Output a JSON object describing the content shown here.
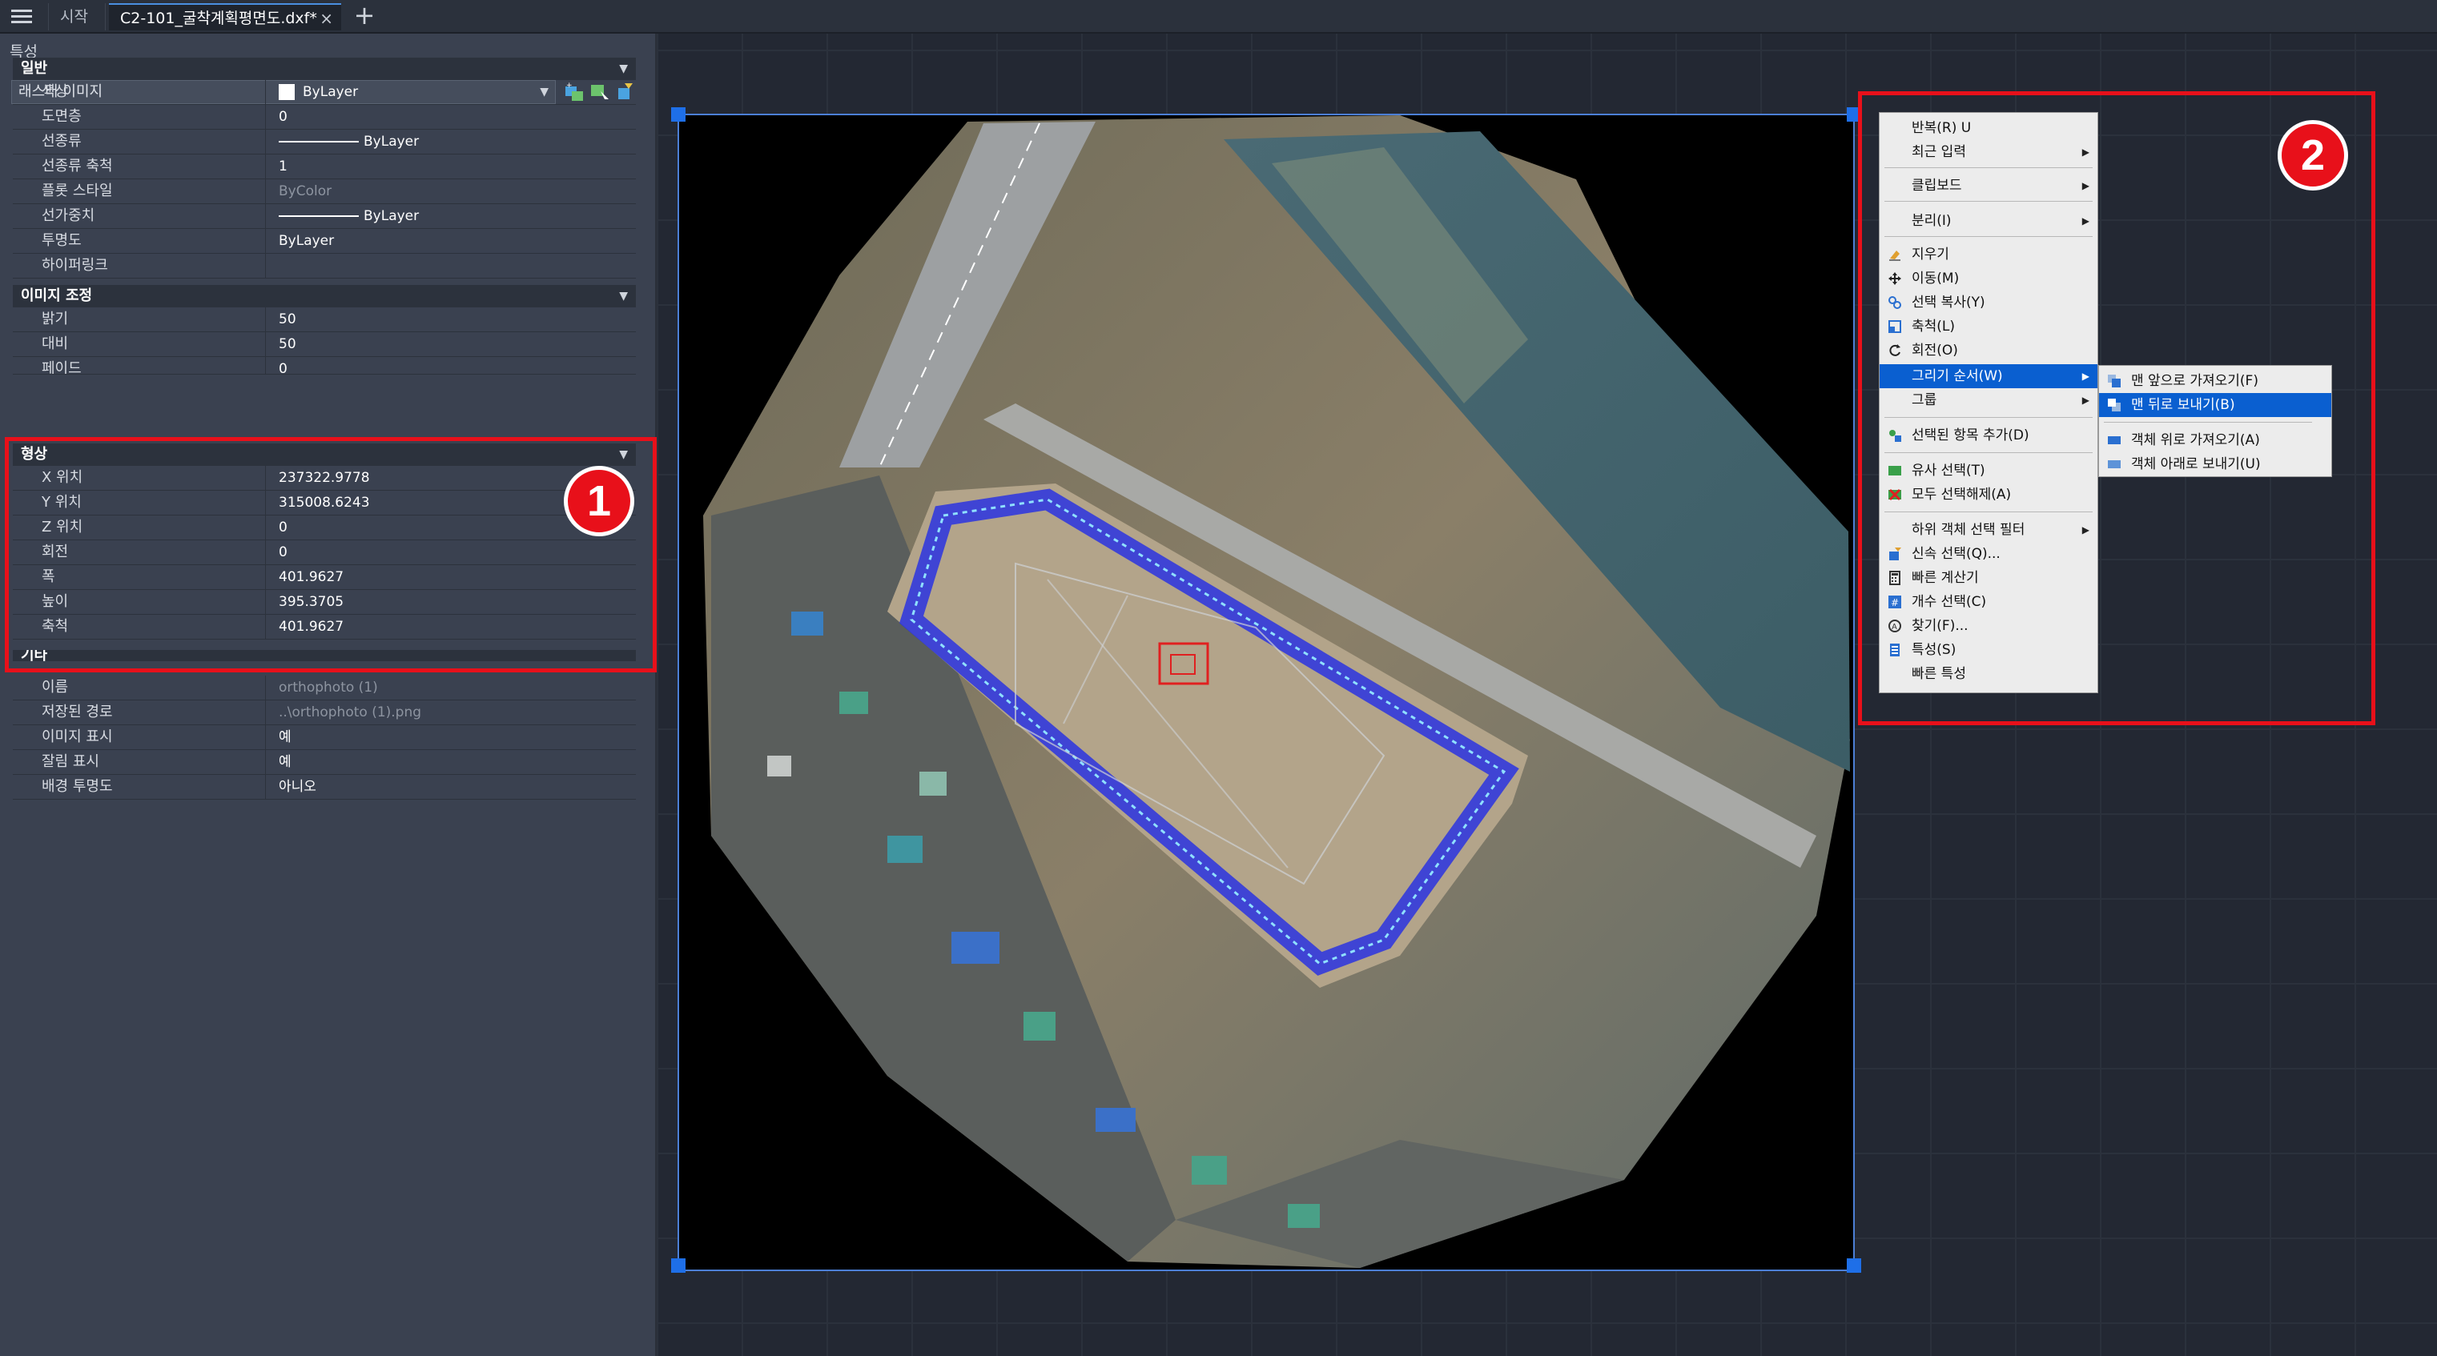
{
  "tabs": {
    "start": "시작",
    "document": "C2-101_굴착계획평면도.dxf*",
    "close": "×",
    "add": "+"
  },
  "panel": {
    "title": "특성",
    "object_type": "래스터 이미지",
    "sections": {
      "general": "일반",
      "image_adjust": "이미지 조정",
      "geometry": "형상",
      "misc": "기타"
    },
    "general_rows": [
      {
        "label": "색상",
        "value": "ByLayer"
      },
      {
        "label": "도면층",
        "value": "0"
      },
      {
        "label": "선종류",
        "value": "ByLayer"
      },
      {
        "label": "선종류 축척",
        "value": "1"
      },
      {
        "label": "플롯 스타일",
        "value": "ByColor"
      },
      {
        "label": "선가중치",
        "value": "ByLayer"
      },
      {
        "label": "투명도",
        "value": "ByLayer"
      },
      {
        "label": "하이퍼링크",
        "value": ""
      }
    ],
    "adjust_rows": [
      {
        "label": "밝기",
        "value": "50"
      },
      {
        "label": "대비",
        "value": "50"
      },
      {
        "label": "페이드",
        "value": "0"
      }
    ],
    "geometry_rows": [
      {
        "label": "X 위치",
        "value": "237322.9778"
      },
      {
        "label": "Y 위치",
        "value": "315008.6243"
      },
      {
        "label": "Z 위치",
        "value": "0"
      },
      {
        "label": "회전",
        "value": "0"
      },
      {
        "label": "폭",
        "value": "401.9627"
      },
      {
        "label": "높이",
        "value": "395.3705"
      },
      {
        "label": "축척",
        "value": "401.9627"
      }
    ],
    "misc_rows": [
      {
        "label": "이름",
        "value": "orthophoto (1)"
      },
      {
        "label": "저장된 경로",
        "value": "..\\orthophoto (1).png"
      },
      {
        "label": "이미지 표시",
        "value": "예"
      },
      {
        "label": "잘림 표시",
        "value": "예"
      },
      {
        "label": "배경 투명도",
        "value": "아니오"
      }
    ]
  },
  "annotations": {
    "badge1": "1",
    "badge2": "2"
  },
  "context_menu": {
    "items": [
      {
        "label": "반복(R) U"
      },
      {
        "label": "최근 입력"
      },
      {
        "label": "클립보드"
      },
      {
        "label": "분리(I)"
      },
      {
        "label": "지우기"
      },
      {
        "label": "이동(M)"
      },
      {
        "label": "선택 복사(Y)"
      },
      {
        "label": "축척(L)"
      },
      {
        "label": "회전(O)"
      },
      {
        "label": "그리기 순서(W)"
      },
      {
        "label": "그룹"
      },
      {
        "label": "선택된 항목 추가(D)"
      },
      {
        "label": "유사 선택(T)"
      },
      {
        "label": "모두 선택해제(A)"
      },
      {
        "label": "하위 객체 선택 필터"
      },
      {
        "label": "신속 선택(Q)..."
      },
      {
        "label": "빠른 계산기"
      },
      {
        "label": "개수 선택(C)"
      },
      {
        "label": "찾기(F)..."
      },
      {
        "label": "특성(S)"
      },
      {
        "label": "빠른 특성"
      }
    ],
    "submenu": [
      {
        "label": "맨 앞으로 가져오기(F)"
      },
      {
        "label": "맨 뒤로 보내기(B)"
      },
      {
        "label": "객체 위로 가져오기(A)"
      },
      {
        "label": "객체 아래로 보내기(U)"
      }
    ]
  },
  "colors": {
    "accent": "#0a5fd0",
    "annotation_red": "#e8101a",
    "selection_blue": "#1e6fe8",
    "panel_bg": "#3a4150",
    "canvas_bg": "#232833"
  }
}
